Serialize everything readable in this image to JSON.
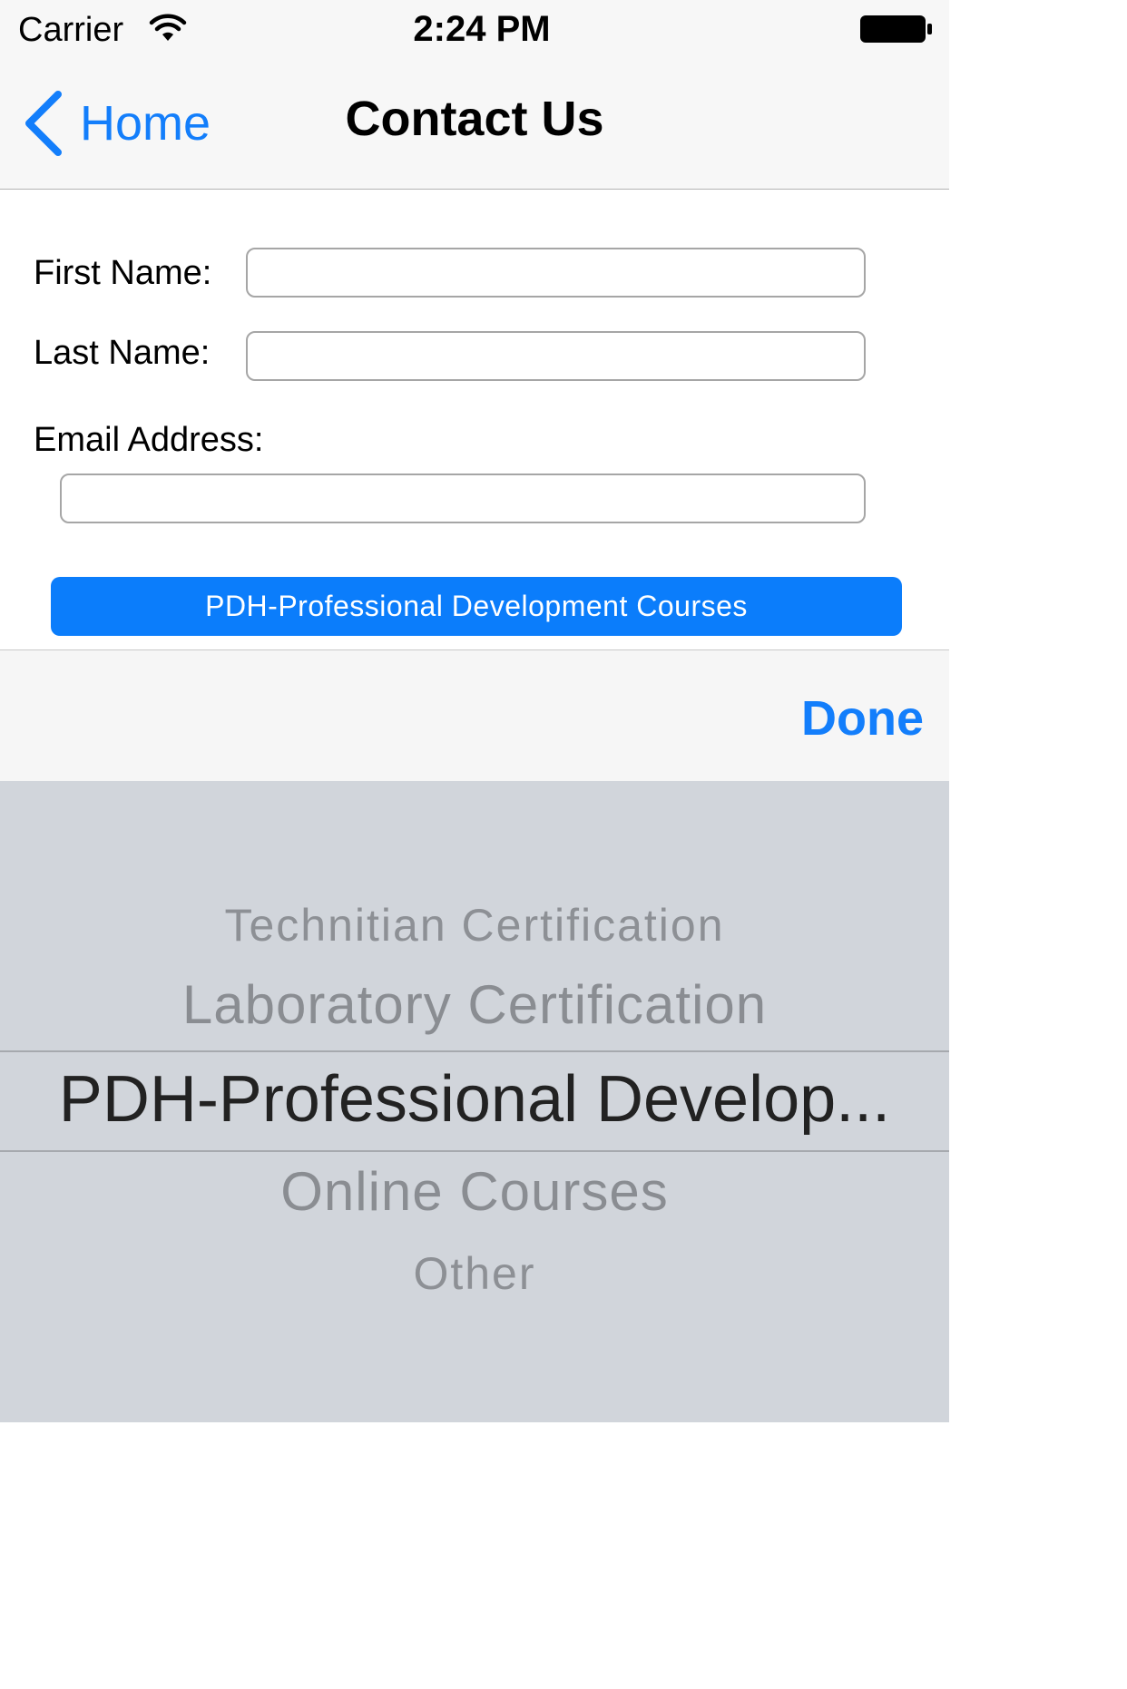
{
  "status_bar": {
    "carrier": "Carrier",
    "time": "2:24 PM",
    "icons": [
      "wifi-icon",
      "battery-icon"
    ]
  },
  "nav": {
    "back_label": "Home",
    "back_icon": "chevron-left-icon",
    "title": "Contact Us"
  },
  "form": {
    "first_name_label": "First Name:",
    "first_name_value": "",
    "last_name_label": "Last Name:",
    "last_name_value": "",
    "email_label": "Email Address:",
    "email_value": "",
    "selected_option_button": "PDH-Professional Development Courses"
  },
  "toolbar": {
    "done_label": "Done"
  },
  "picker": {
    "options": [
      "Technitian Certification",
      "Laboratory Certification",
      "PDH-Professional Develop...",
      "Online Courses",
      "Other"
    ],
    "selected_index": 2
  },
  "colors": {
    "accent": "#137efb",
    "button_bg": "#0b7dfb",
    "picker_bg": "#d1d5db",
    "nav_bg": "#f7f7f7"
  }
}
